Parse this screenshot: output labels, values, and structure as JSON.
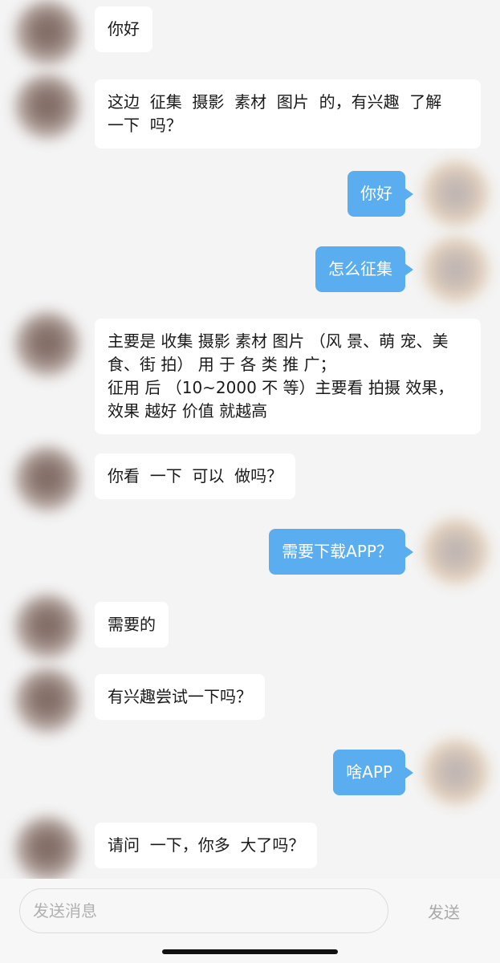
{
  "messages": [
    {
      "side": "left",
      "text": "你好"
    },
    {
      "side": "left",
      "text": "这边  征集  摄影  素材  图片  的，有兴趣  了解\n一下  吗？"
    },
    {
      "side": "right",
      "text": "你好"
    },
    {
      "side": "right",
      "text": "怎么征集"
    },
    {
      "side": "left",
      "text": "主要是 收集 摄影 素材 图片 （风 景、萌 宠、美\n食、街 拍） 用 于 各 类 推 广；\n征用 后 （10~2000 不 等）主要看 拍摄 效果，\n效果 越好 价值 就越高"
    },
    {
      "side": "left",
      "text": "你看  一下  可以  做吗？"
    },
    {
      "side": "right",
      "text": "需要下载APP？"
    },
    {
      "side": "left",
      "text": "需要的"
    },
    {
      "side": "left",
      "text": "有兴趣尝试一下吗？"
    },
    {
      "side": "right",
      "text": "啥APP"
    },
    {
      "side": "left",
      "text": "请问  一下，你多  大了吗？"
    }
  ],
  "input": {
    "placeholder": "发送消息",
    "value": ""
  },
  "send_label": "发送",
  "colors": {
    "background": "#f4f4f4",
    "incoming_bubble": "#ffffff",
    "outgoing_bubble": "#5aaeef",
    "send_disabled": "#a8a8a8"
  }
}
